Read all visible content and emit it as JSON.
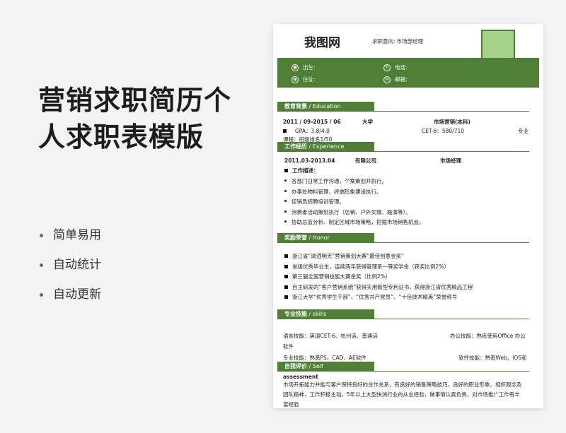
{
  "promo": {
    "title_line1": "营销求职简历个",
    "title_line2": "人求职表模版",
    "features": [
      "简单易用",
      "自动统计",
      "自动更新"
    ]
  },
  "resume": {
    "name": "我图网",
    "intent_label": "求职意向:",
    "intent_value": "市场部经理",
    "info": {
      "birth_label": "出生:",
      "birth_value": "",
      "phone_label": "电话:",
      "phone_value": "",
      "address_label": "住址:",
      "address_value": "",
      "email_label": "邮箱:",
      "email_value": ""
    },
    "education": {
      "title_cn": "教育背景",
      "title_en": " / Education",
      "period": "2011 / 09-2015 / 06",
      "school": "大学",
      "major": "市场营销(本科)",
      "gpa": "GPA：3.8/4.0",
      "cet": "CET-6：580/710",
      "major_tag": "专业",
      "course": "课程：班级排名1/50"
    },
    "experience": {
      "title_cn": "工作经历",
      "title_en": " / Experience",
      "period": "2011.03-2013.04",
      "company": "有限公司",
      "role": "市场经理",
      "desc_title": "工作描述：",
      "items": [
        "各部门日常工作沟通，个案策划并执行。",
        "办事处物料管理、终端形象建设执行。",
        "促销员招聘培训管理。",
        "消费者活动策划执行（店销、户外买赠、路演等）。",
        "协助总监分析、制定区域市场策略，挖掘市场销售机会。"
      ]
    },
    "honor": {
      "title_cn": "奖励荣誉",
      "title_en": " / Honor",
      "items": [
        "浙江省“潇洒明天”营销策划大赛“最佳创意金奖”",
        "省级优秀毕业生，连续两年获得管理系一等奖学金（获奖比例2%）",
        "第三届全国营销技能大赛金奖（比例2%）",
        "自主研发的“客户营销系统”获得实用新型专利证书，获得浙江省优秀精品工程",
        "浙江大学“优秀学生干部”、“优秀共产党员”、“十佳技术精英”荣誉称号"
      ]
    },
    "skills": {
      "title_cn": "专业技能",
      "title_en": " /    skills",
      "lang": "语言技能：英语CET-6、杭州话、普通话",
      "office": "办公技能：熟练使用Office 办公",
      "office_cont": "软件",
      "pro": "专业技能：熟悉PS、CAD、AE软件",
      "soft": "软件技能：熟悉Web、iOS和"
    },
    "self": {
      "title_cn": "自我评价",
      "title_en": " / Self",
      "title_en2": "assessment",
      "line1": "市场开拓能力并能与客户保持良好的合作关系，有良好的销售策略技巧，良好的职业形象、组织观念及",
      "line2": "团队精神，工作积极主动，5年以上大型快消行业的从业经验，做事情认真负责，对市场推广工作有丰",
      "line3": "富经验"
    }
  }
}
